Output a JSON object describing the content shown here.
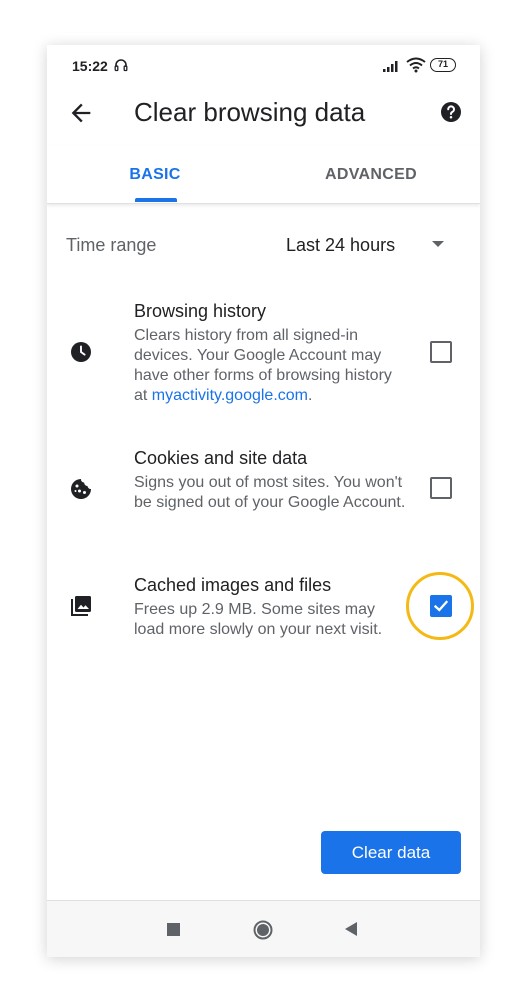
{
  "status_bar": {
    "time": "15:22",
    "battery": "71",
    "icons": [
      "headset-icon",
      "signal-icon",
      "wifi-icon",
      "battery-icon"
    ]
  },
  "app_bar": {
    "title": "Clear browsing data",
    "back_icon": "arrow-back-icon",
    "help_icon": "help-icon"
  },
  "tabs": [
    {
      "label": "BASIC",
      "selected": true
    },
    {
      "label": "ADVANCED",
      "selected": false
    }
  ],
  "time_range": {
    "label": "Time range",
    "value": "Last 24 hours"
  },
  "options": [
    {
      "icon": "clock-icon",
      "title": "Browsing history",
      "description": "Clears history from all signed-in devices. Your Google Account may have other forms of browsing history at ",
      "link": "myactivity.google.com",
      "description_end": ".",
      "checked": false
    },
    {
      "icon": "cookie-icon",
      "title": "Cookies and site data",
      "description": "Signs you out of most sites. You won't be signed out of your Google Account.",
      "checked": false
    },
    {
      "icon": "image-icon",
      "title": "Cached images and files",
      "description": "Frees up 2.9 MB. Some sites may load more slowly on your next visit.",
      "checked": true
    }
  ],
  "clear_button": {
    "label": "Clear data"
  },
  "colors": {
    "accent": "#1a73e8",
    "highlight": "#f5b915",
    "text_primary": "#202124",
    "text_secondary": "#5f6368"
  }
}
